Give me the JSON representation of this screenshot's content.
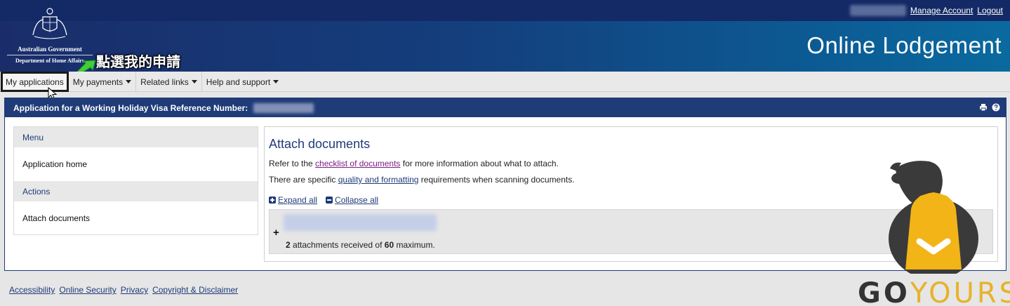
{
  "header": {
    "gov_line1": "Australian Government",
    "gov_line2": "Department of Home Affairs",
    "title": "Online Lodgement",
    "manage_account": "Manage Account",
    "logout": "Logout"
  },
  "annotation": "點選我的申請",
  "nav": {
    "items": [
      {
        "label": "My applications",
        "dropdown": false
      },
      {
        "label": "My payments",
        "dropdown": true
      },
      {
        "label": "Related links",
        "dropdown": true
      },
      {
        "label": "Help and support",
        "dropdown": true
      }
    ]
  },
  "panel": {
    "heading": "Application for a Working Holiday Visa Reference Number:"
  },
  "sidebar": {
    "menu_heading": "Menu",
    "menu_items": [
      "Application home"
    ],
    "actions_heading": "Actions",
    "action_items": [
      "Attach documents"
    ]
  },
  "main": {
    "title": "Attach documents",
    "line1_pre": "Refer to the ",
    "line1_link": "checklist of documents",
    "line1_post": " for more information about what to attach.",
    "line2_pre": "There are specific ",
    "line2_link": "quality and formatting",
    "line2_post": " requirements when scanning documents.",
    "expand_all": "Expand all",
    "collapse_all": "Collapse all",
    "attachments": {
      "received": "2",
      "mid_text": " attachments received of ",
      "maximum": "60",
      "end_text": " maximum."
    }
  },
  "footer": {
    "links": [
      "Accessibility",
      "Online Security",
      "Privacy",
      "Copyright & Disclaimer"
    ]
  },
  "watermark": {
    "part1": "GO",
    "part2": "YOURS"
  },
  "colors": {
    "brand_navy": "#1f3b78",
    "link_purple": "#7b1d86",
    "watermark_yellow": "#e8b22a"
  }
}
